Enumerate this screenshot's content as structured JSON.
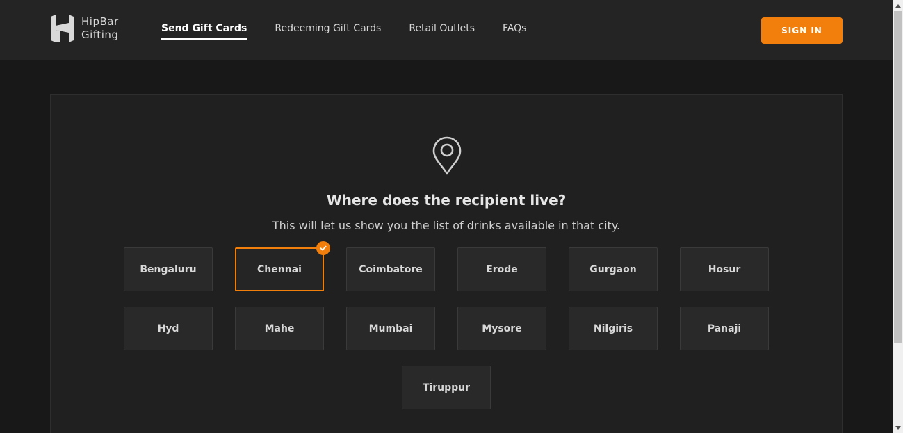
{
  "brand": {
    "line1": "HipBar",
    "line2": "Gifting",
    "logo_icon": "hipbar-logo-icon"
  },
  "nav": {
    "items": [
      {
        "label": "Send Gift Cards",
        "active": true
      },
      {
        "label": "Redeeming Gift Cards",
        "active": false
      },
      {
        "label": "Retail Outlets",
        "active": false
      },
      {
        "label": "FAQs",
        "active": false
      }
    ]
  },
  "signin_label": "SIGN IN",
  "colors": {
    "accent": "#f27f0c",
    "background": "#181818",
    "header": "#242424",
    "panel": "#202020",
    "tile": "#292929"
  },
  "location": {
    "icon": "location-pin-icon",
    "question": "Where does the recipient live?",
    "subtext": "This will let us show you the list of drinks available in that city."
  },
  "cities": [
    {
      "name": "Bengaluru",
      "selected": false
    },
    {
      "name": "Chennai",
      "selected": true
    },
    {
      "name": "Coimbatore",
      "selected": false
    },
    {
      "name": "Erode",
      "selected": false
    },
    {
      "name": "Gurgaon",
      "selected": false
    },
    {
      "name": "Hosur",
      "selected": false
    },
    {
      "name": "Hyd",
      "selected": false
    },
    {
      "name": "Mahe",
      "selected": false
    },
    {
      "name": "Mumbai",
      "selected": false
    },
    {
      "name": "Mysore",
      "selected": false
    },
    {
      "name": "Nilgiris",
      "selected": false
    },
    {
      "name": "Panaji",
      "selected": false
    },
    {
      "name": "Tiruppur",
      "selected": false
    }
  ]
}
